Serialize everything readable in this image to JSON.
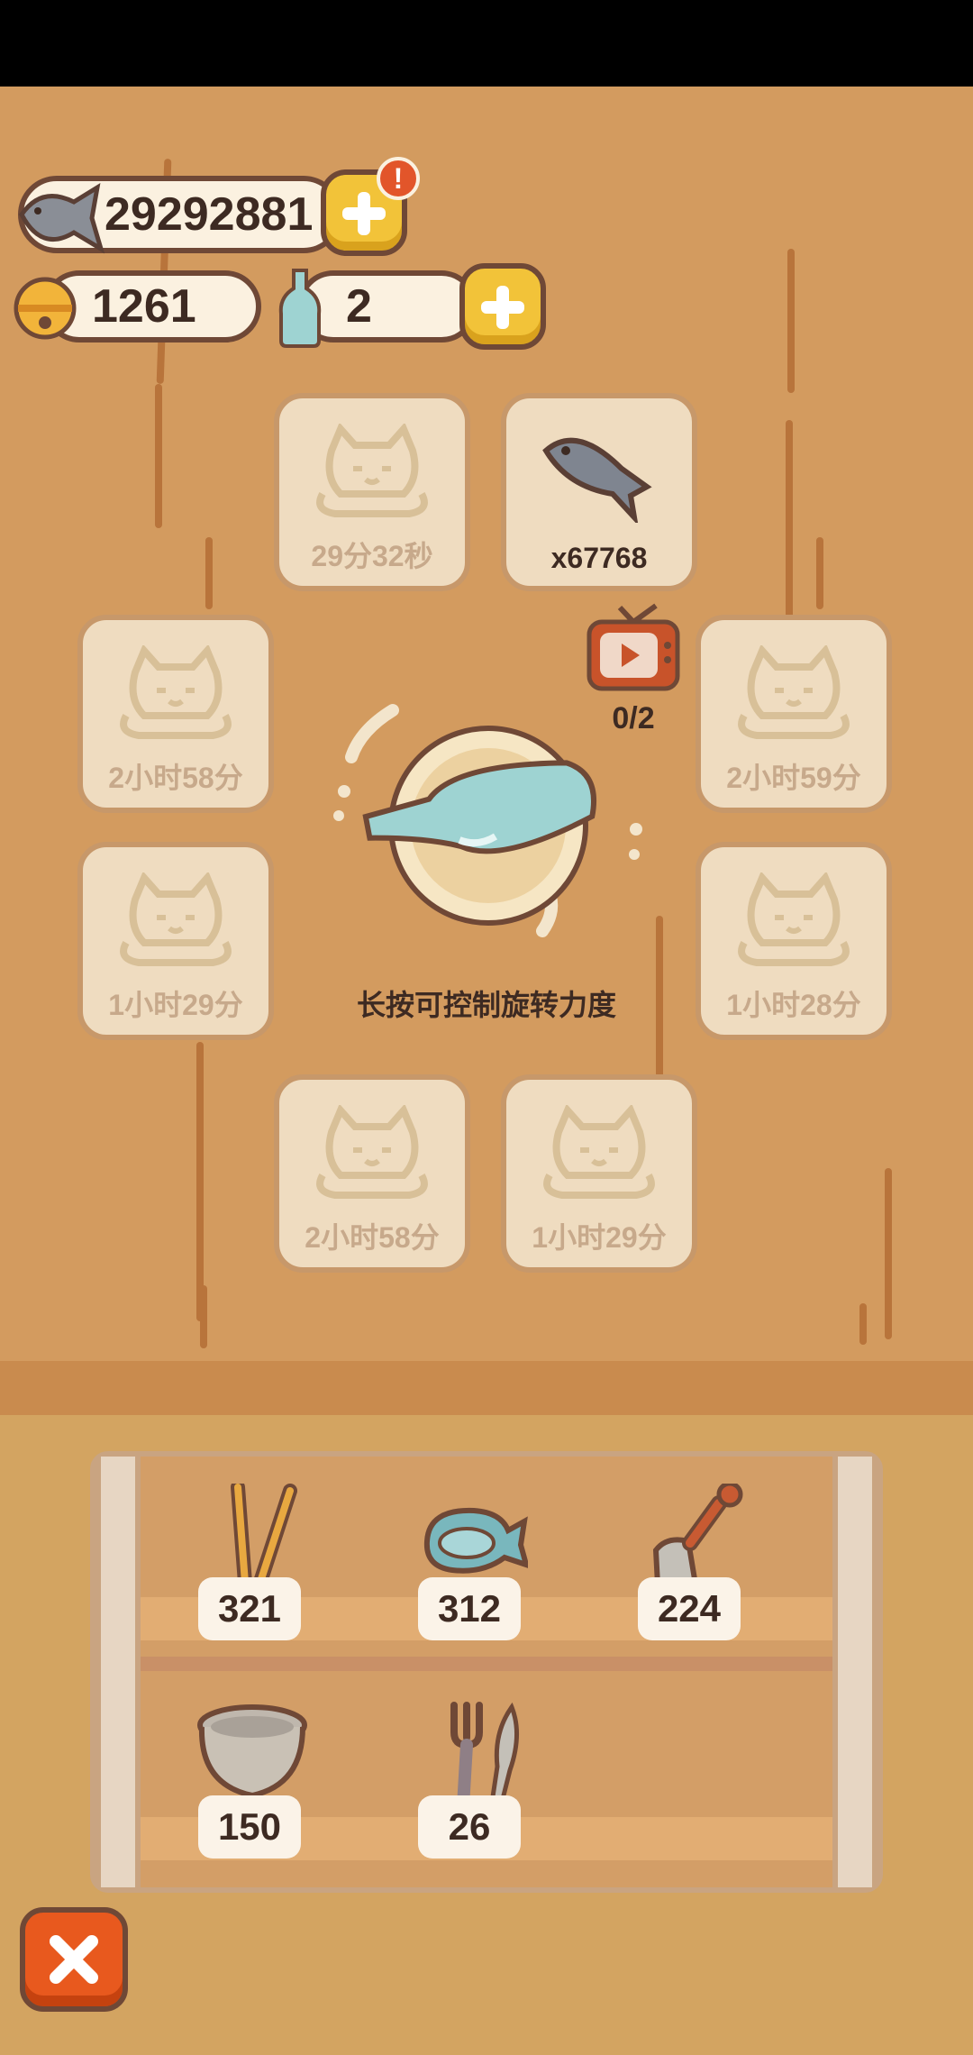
{
  "currency": {
    "fish": "29292881",
    "bell": "1261",
    "bottle": "2"
  },
  "alert_badge": "!",
  "slots": [
    {
      "label": "29分32秒"
    },
    {
      "label": "x67768"
    },
    {
      "label": "2小时58分"
    },
    {
      "label": "2小时59分"
    },
    {
      "label": "1小时29分"
    },
    {
      "label": "1小时28分"
    },
    {
      "label": "2小时58分"
    },
    {
      "label": "1小时29分"
    }
  ],
  "tv_count": "0/2",
  "hint": "长按可控制旋转力度",
  "shelf_items": [
    {
      "icon": "chopsticks-icon",
      "count": "321"
    },
    {
      "icon": "fish-plate-icon",
      "count": "312"
    },
    {
      "icon": "spatula-icon",
      "count": "224"
    },
    {
      "icon": "bowl-icon",
      "count": "150"
    },
    {
      "icon": "fork-knife-icon",
      "count": "26"
    }
  ],
  "colors": {
    "wall": "#d39b5f",
    "slot_bg": "#efdcc0",
    "accent_yellow": "#f2c339",
    "close_orange": "#e8591e"
  }
}
